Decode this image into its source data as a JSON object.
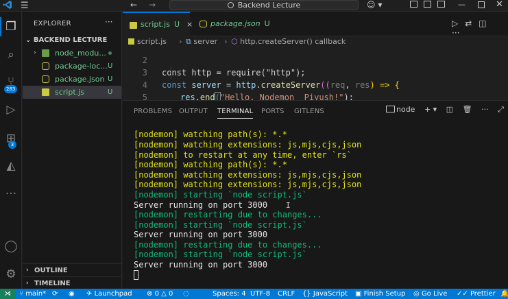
{
  "titlebar": {
    "menu_icon": "hamburger-menu-icon",
    "search_text": "Backend Lecture"
  },
  "activity": {
    "source_control_badge": "283",
    "extensions_badge": "3"
  },
  "sidebar": {
    "title": "EXPLORER",
    "more": "···",
    "folder": "BACKEND LECTURE",
    "items": [
      {
        "name": "node_modu...",
        "status": "",
        "icon": "folder-icon"
      },
      {
        "name": "package-loc...",
        "status": "U",
        "icon": "json-icon"
      },
      {
        "name": "package.json",
        "status": "U",
        "icon": "json-icon"
      },
      {
        "name": "script.js",
        "status": "U",
        "icon": "js-icon"
      }
    ],
    "outline": "OUTLINE",
    "timeline": "TIMELINE"
  },
  "tabs": [
    {
      "name": "script.js",
      "status": "U",
      "close": "×"
    },
    {
      "name": "package.json",
      "status": "U"
    }
  ],
  "breadcrumb": {
    "file": "script.js",
    "symbol1": "server",
    "symbol2": "http.createServer() callback"
  },
  "editor": {
    "line_numbers": [
      "2",
      "3",
      "4",
      "5"
    ],
    "line2": "const http = require(\"http\");",
    "line3_kw": "const",
    "line3_var": "server",
    "line3_eq": " = ",
    "line3_obj": "http",
    "line3_dot": ".",
    "line3_fn": "createServer",
    "line3_p1": "((",
    "line3_req": "req",
    "line3_comma": ", ",
    "line3_res": "res",
    "line3_arrow": ") => {",
    "line4_res": "res",
    "line4_dot": ".",
    "line4_fn": "end",
    "line4_open": "(",
    "line4_str": "\"Hello, Nodemon  Piyush!\"",
    "line4_close": ");",
    "line5": "});"
  },
  "panel": {
    "tabs": [
      "PROBLEMS",
      "OUTPUT",
      "TERMINAL",
      "PORTS",
      "GITLENS"
    ],
    "active_tab": "TERMINAL",
    "terminal_name": "node",
    "terminal_lines": [
      {
        "text": "[nodemon] watching path(s): *.*",
        "color": "yellow"
      },
      {
        "text": "[nodemon] watching extensions: js,mjs,cjs,json",
        "color": "yellow"
      },
      {
        "text": "[nodemon] to restart at any time, enter `rs`",
        "color": "yellow"
      },
      {
        "text": "[nodemon] watching path(s): *.*",
        "color": "yellow"
      },
      {
        "text": "[nodemon] watching extensions: js,mjs,cjs,json",
        "color": "yellow"
      },
      {
        "text": "[nodemon] watching extensions: js,mjs,cjs,json",
        "color": "yellow"
      },
      {
        "text": "[nodemon] starting `node script.js`",
        "color": "green"
      },
      {
        "text": "Server running on port 3000",
        "color": "white"
      },
      {
        "text": "[nodemon] restarting due to changes...",
        "color": "green"
      },
      {
        "text": "[nodemon] starting `node script.js`",
        "color": "green"
      },
      {
        "text": "Server running on port 3000",
        "color": "white"
      },
      {
        "text": "[nodemon] restarting due to changes...",
        "color": "green"
      },
      {
        "text": "[nodemon] starting `node script.js`",
        "color": "green"
      },
      {
        "text": "Server running on port 3000",
        "color": "white"
      }
    ]
  },
  "statusbar": {
    "remote_icon": "remote-icon",
    "branch": "main*",
    "launchpad": "Launchpad",
    "errors": "0",
    "warnings": "0",
    "spaces": "Spaces: 4",
    "encoding": "UTF-8",
    "eol": "CRLF",
    "language": "JavaScript",
    "finish_setup": "Finish Setup",
    "go_live": "Go Live",
    "prettier": "Prettier"
  },
  "colors": {
    "accent": "#0078d4",
    "git_untracked": "#73c991",
    "terminal_yellow": "#e5e510",
    "terminal_green": "#0dbc79"
  }
}
